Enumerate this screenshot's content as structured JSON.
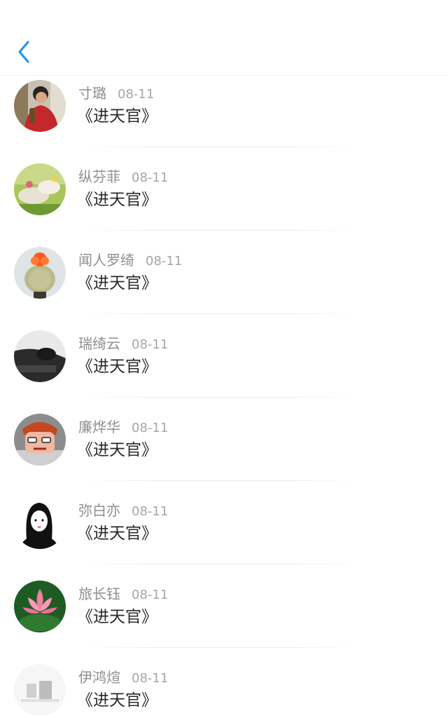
{
  "header": {
    "back_icon": "chevron-left-icon",
    "accent_color": "#2196f3"
  },
  "comments": [
    {
      "name": "寸璐",
      "date": "08-11",
      "title": "《进天官》",
      "avatar": "avatar-red-sweater-person"
    },
    {
      "name": "纵芬菲",
      "date": "08-11",
      "title": "《进天官》",
      "avatar": "avatar-flowers-grass"
    },
    {
      "name": "闻人罗绮",
      "date": "08-11",
      "title": "《进天官》",
      "avatar": "avatar-cactus-red-flower"
    },
    {
      "name": "瑞绮云",
      "date": "08-11",
      "title": "《进天官》",
      "avatar": "avatar-bw-sleeping-person"
    },
    {
      "name": "廉烨华",
      "date": "08-11",
      "title": "《进天官》",
      "avatar": "avatar-cartoon-redhead"
    },
    {
      "name": "弥白亦",
      "date": "08-11",
      "title": "《进天官》",
      "avatar": "avatar-girl-sketch"
    },
    {
      "name": "旅长钰",
      "date": "08-11",
      "title": "《进天官》",
      "avatar": "avatar-pink-lotus"
    },
    {
      "name": "伊鸿煊",
      "date": "08-11",
      "title": "《进天官》",
      "avatar": "avatar-grey-abstract"
    }
  ]
}
